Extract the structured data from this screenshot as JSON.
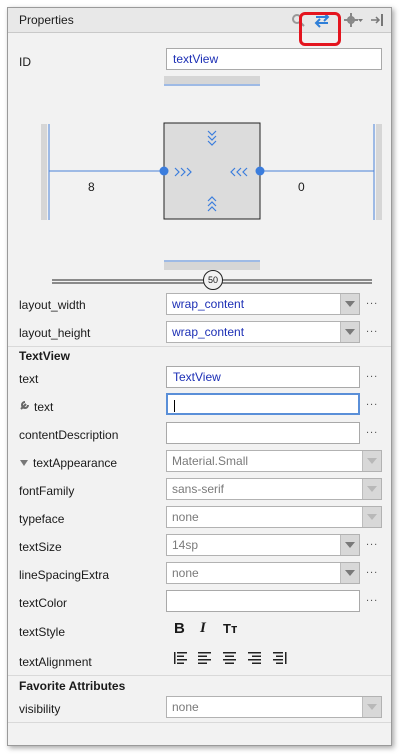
{
  "header": {
    "title": "Properties"
  },
  "id_row": {
    "label": "ID",
    "value": "textView"
  },
  "constraint": {
    "left_margin": "8",
    "right_margin": "0",
    "bias": "50"
  },
  "layout_width": {
    "label": "layout_width",
    "value": "wrap_content"
  },
  "layout_height": {
    "label": "layout_height",
    "value": "wrap_content"
  },
  "textview_section": {
    "title": "TextView"
  },
  "text_row": {
    "label": "text",
    "value": "TextView"
  },
  "tools_text_row": {
    "label": "text",
    "value": ""
  },
  "content_description": {
    "label": "contentDescription",
    "value": ""
  },
  "text_appearance": {
    "label": "textAppearance",
    "value": "Material.Small"
  },
  "font_family": {
    "label": "fontFamily",
    "value": "sans-serif"
  },
  "typeface": {
    "label": "typeface",
    "value": "none"
  },
  "text_size": {
    "label": "textSize",
    "value": "14sp"
  },
  "line_spacing_extra": {
    "label": "lineSpacingExtra",
    "value": "none"
  },
  "text_color": {
    "label": "textColor",
    "value": ""
  },
  "text_style": {
    "label": "textStyle",
    "bold": "B",
    "italic": "I",
    "caps": "Tт"
  },
  "text_alignment": {
    "label": "textAlignment"
  },
  "favorites_section": {
    "title": "Favorite Attributes"
  },
  "visibility": {
    "label": "visibility",
    "value": "none"
  },
  "more_dots": "...",
  "colors": {
    "accent_blue": "#3b7ddd",
    "highlight_red": "#e4151f"
  },
  "icons": [
    "search-icon",
    "swap-view-icon",
    "gear-icon",
    "pin-to-side-icon",
    "wrench-icon",
    "collapse-triangle-icon"
  ]
}
